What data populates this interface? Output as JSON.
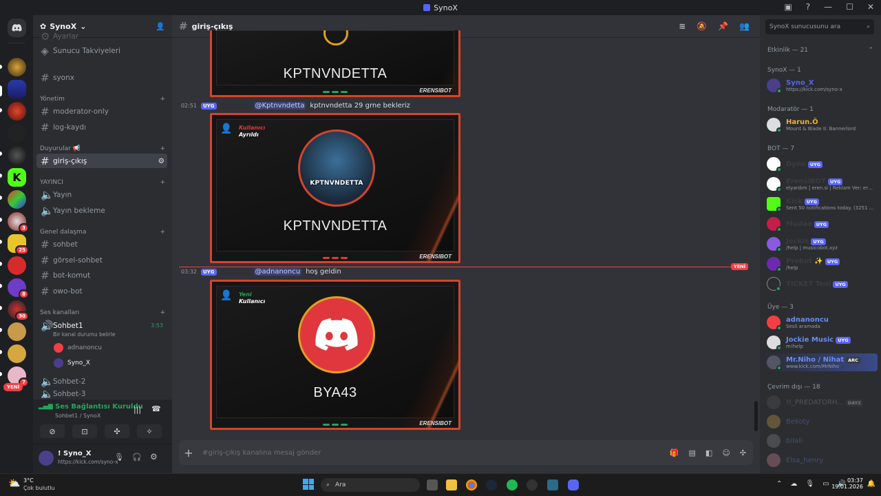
{
  "window": {
    "title": "SynoX"
  },
  "server": {
    "name": "SynoX"
  },
  "channels": {
    "top_partial": "Ayarlar",
    "boosts": "Sunucu Takviyeleri",
    "synox": "syonx",
    "cat_yonetim": "Yönetim",
    "moderator": "moderator-only",
    "logs": "log-kaydı",
    "cat_duyurular": "Duyurular",
    "giris": "giriş-çıkış",
    "cat_yayinci": "YAYINCI",
    "yayin": "Yayın",
    "yayin_bekleme": "Yayın bekleme",
    "cat_genel": "Genel dalaşma",
    "sohbet": "sohbet",
    "gorsel": "görsel-sohbet",
    "botkomut": "bot-komut",
    "owo": "owo-bot",
    "cat_ses": "Ses kanalları",
    "sohbet1": "Sohbet1",
    "sohbet1_time": "3:53",
    "sohbet1_status": "Bir kanal durumu belirle",
    "vuser1": "adnanoncu",
    "vuser2": "Syno_X",
    "sohbet2": "Sohbet-2",
    "sohbet3": "Sohbet-3"
  },
  "new_badge": "YENİ",
  "voice": {
    "status": "Ses Bağlantısı Kuruldu",
    "channel": "Sohbet1 / SynoX"
  },
  "user": {
    "name": "! Syno_X",
    "status": "https://kick.com/syno-x"
  },
  "main": {
    "channel": "giriş-çıkış",
    "card1_name": "KPTNVNDETTA",
    "msg1_time": "02:51",
    "msg1_tag": "UYG",
    "msg1_mention": "@Kptnvndetta",
    "msg1_text": "kptnvndetta  29 grne bekleriz",
    "card2_label_top": "Kullanıcı",
    "card2_label_bottom": "Ayrıldı",
    "card2_name": "KPTNVNDETTA",
    "avatar_text": "KPTNVNDETTA",
    "brand": "ERENSIBOT",
    "new_divider": "YENİ",
    "msg2_time": "03:32",
    "msg2_tag": "UYG",
    "msg2_mention": "@adnanoncu",
    "msg2_text": "hoş geldin",
    "card3_label_top": "Yeni",
    "card3_label_bottom": "Kullanıcı",
    "card3_name": "BYA43",
    "composer_placeholder": "#giriş-çıkış kanalına mesaj gönder"
  },
  "members": {
    "search_placeholder": "SynoX sunucusunu ara",
    "activity": "Etkinlik — 21",
    "g_synox": "SynoX — 1",
    "m_synox_name": "Syno_X",
    "m_synox_sub": "https://kick.com/syno-x",
    "g_mod": "Modaratör — 1",
    "m_harun_name": "Harun.Ö",
    "m_harun_sub": "Mount & Blade II: Bannerlord",
    "g_bot": "BOT — 7",
    "bots": [
      {
        "name": "Dyno",
        "tag": "UYG",
        "sub": ""
      },
      {
        "name": "ErensiBOT",
        "tag": "UYG",
        "sub": "elyardım | eren.si | Reklam Ver: ere..."
      },
      {
        "name": "Kick",
        "tag": "UYG",
        "sub": "Sent 50 notifications today. (3251 ..."
      },
      {
        "name": "Mudae",
        "tag": "UYG",
        "sub": ""
      },
      {
        "name": "Jockie",
        "tag": "UYG",
        "sub": "/help | musicobot.xyz"
      },
      {
        "name": "Probot",
        "tag": "UYG",
        "sub": "/help"
      },
      {
        "name": "TICKET Tool",
        "tag": "UYG",
        "sub": ""
      }
    ],
    "g_uye": "Üye — 3",
    "m_adnan_name": "adnanoncu",
    "m_adnan_sub": "Sesli aramada",
    "m_jockie_name": "Jockie Music",
    "m_jockie_tag": "UYG",
    "m_jockie_sub": "m!help",
    "m_niho_name": "Mr.Niho / Nihat",
    "m_niho_tag": "ARC",
    "m_niho_sub": "www.kick.com/MrNiho",
    "g_offline": "Çevrim dışı — 18",
    "off1": "!!_PREDATORH...",
    "off1_tag": "DAYZ",
    "off2": "Bekoty",
    "off3": "bilali",
    "off4": "Elsa_henry"
  },
  "taskbar": {
    "weather_temp": "3°C",
    "weather_desc": "Çok bulutlu",
    "search": "Ara",
    "time": "03:37",
    "date": "19.01.2026"
  },
  "colors": {
    "accent": "#5865f2",
    "online": "#23a55a",
    "danger": "#f23f43",
    "card_border": "#d8442a"
  }
}
